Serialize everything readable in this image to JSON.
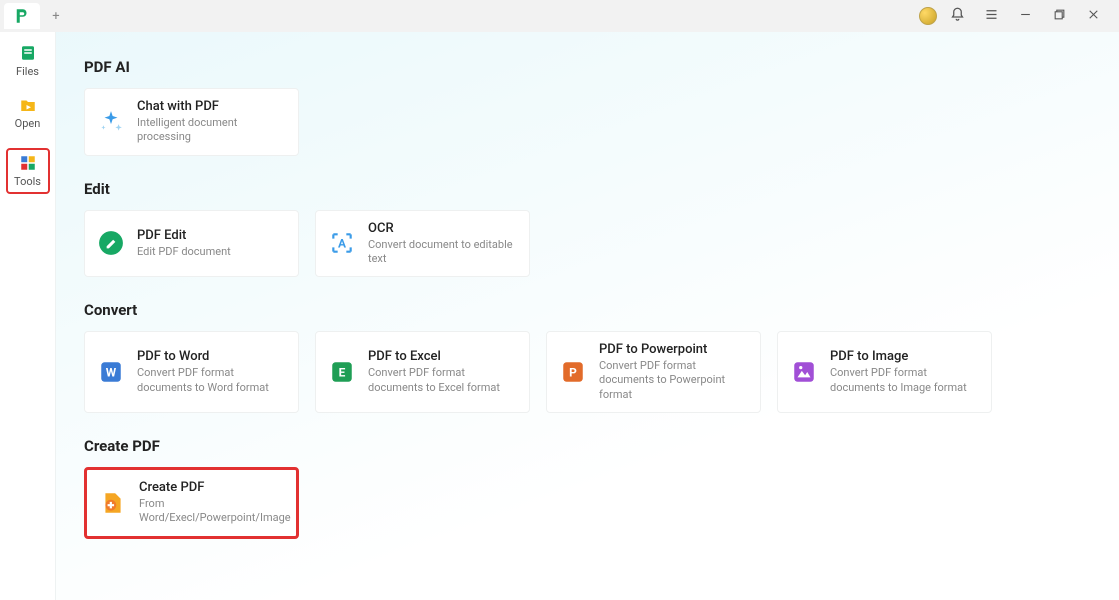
{
  "titlebar": {
    "plus_label": "+"
  },
  "sidebar": {
    "items": [
      {
        "label": "Files"
      },
      {
        "label": "Open"
      },
      {
        "label": "Tools"
      }
    ]
  },
  "sections": {
    "pdf_ai": {
      "title": "PDF AI",
      "cards": [
        {
          "title": "Chat with PDF",
          "desc": "Intelligent document processing"
        }
      ]
    },
    "edit": {
      "title": "Edit",
      "cards": [
        {
          "title": "PDF Edit",
          "desc": "Edit PDF document"
        },
        {
          "title": "OCR",
          "desc": "Convert document to editable text"
        }
      ]
    },
    "convert": {
      "title": "Convert",
      "cards": [
        {
          "title": "PDF to Word",
          "desc": "Convert PDF format documents to Word format"
        },
        {
          "title": "PDF to Excel",
          "desc": "Convert PDF format documents to Excel format"
        },
        {
          "title": "PDF to Powerpoint",
          "desc": "Convert PDF format documents to Powerpoint format"
        },
        {
          "title": "PDF to Image",
          "desc": "Convert PDF format documents to Image format"
        }
      ]
    },
    "create": {
      "title": "Create PDF",
      "cards": [
        {
          "title": "Create PDF",
          "desc": "From Word/Execl/Powerpoint/Image"
        }
      ]
    }
  }
}
